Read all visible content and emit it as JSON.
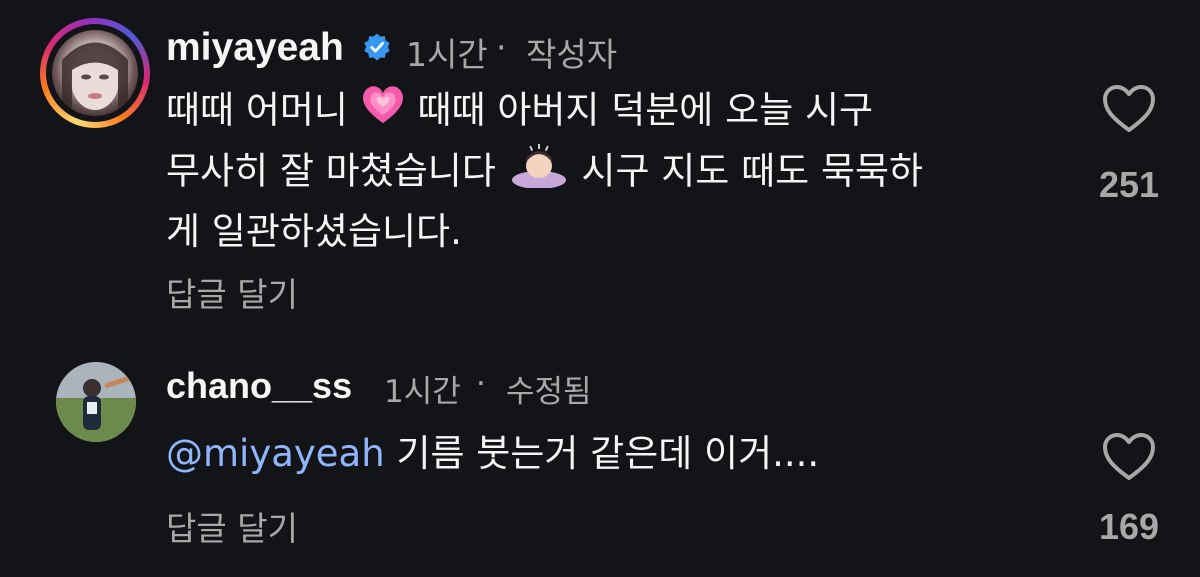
{
  "comments": [
    {
      "username": "miyayeah",
      "verified": true,
      "time": "1시간",
      "separator": "·",
      "tag": "작성자",
      "lines": [
        {
          "pre": "때때 어머니",
          "emoji": "growing-heart-emoji",
          "post": " 때때 아버지 덕분에 오늘 시구"
        },
        {
          "pre": "무사히 잘 마쳤습니다",
          "emoji": "person-bowing-emoji",
          "post": " 시구 지도 때도 묵묵하"
        },
        {
          "pre": "게 일관하셨습니다.",
          "emoji": "",
          "post": ""
        }
      ],
      "reply_label": "답글 달기",
      "likes": "251"
    },
    {
      "username": "chano__ss",
      "verified": false,
      "time": "1시간",
      "separator": "·",
      "tag": "수정됨",
      "mention": "@miyayeah",
      "text": " 기름 붓는거 같은데 이거....",
      "reply_label": "답글 달기",
      "likes": "169"
    }
  ],
  "colors": {
    "background": "#121417",
    "text": "#f5f5f5",
    "secondary": "#a8a8a8",
    "mention": "#8fb6ff",
    "verified": "#3897f0"
  },
  "icons": [
    "heart-outline-icon",
    "verified-badge-icon"
  ]
}
